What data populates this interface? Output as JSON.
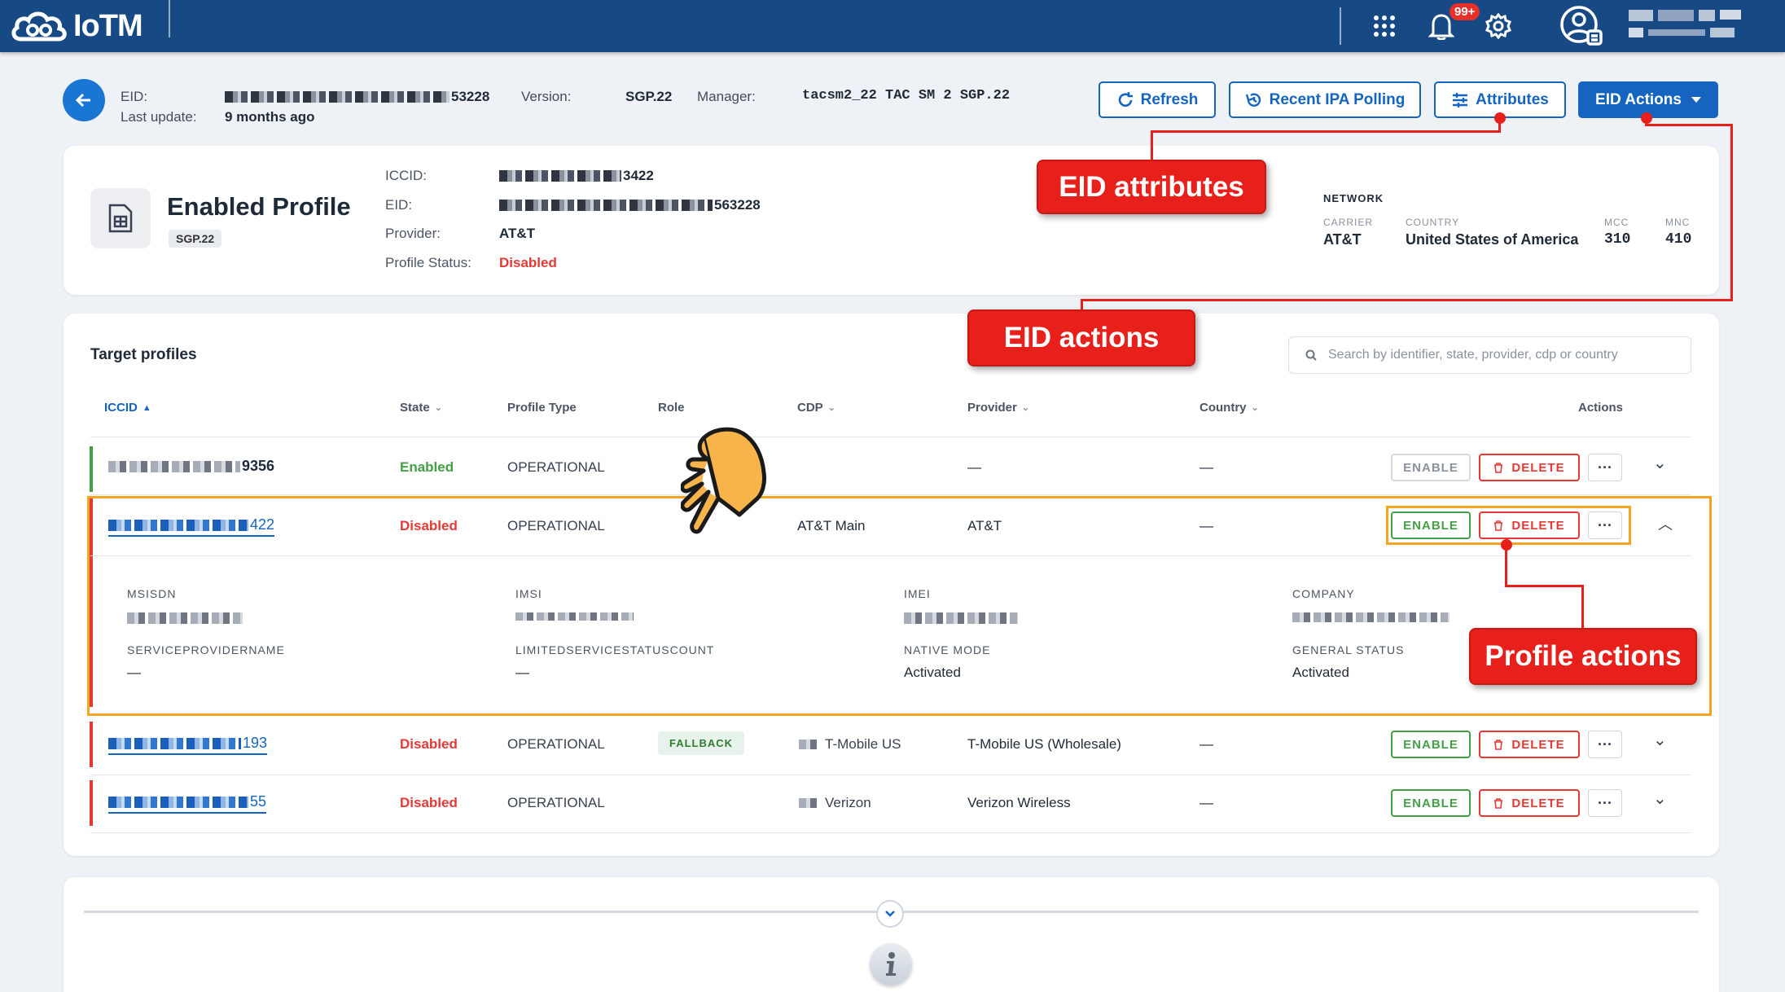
{
  "topbar": {
    "app_name": "IoTM",
    "notification_count": "99+",
    "icons": [
      "apps-grid-icon",
      "bell-icon",
      "gear-icon",
      "user-avatar-icon"
    ]
  },
  "header": {
    "eid_label": "EID:",
    "eid_value": "53228",
    "last_update_label": "Last update:",
    "last_update_value": "9 months ago",
    "version_label": "Version:",
    "version_value": "SGP.22",
    "manager_label": "Manager:",
    "manager_value": "tacsm2_22 TAC SM 2 SGP.22",
    "buttons": {
      "refresh": "Refresh",
      "recent_ipa": "Recent IPA Polling",
      "attributes": "Attributes",
      "eid_actions": "EID Actions"
    }
  },
  "enabled_profile": {
    "title": "Enabled Profile",
    "badge": "SGP.22",
    "iccid_label": "ICCID:",
    "iccid_value": "3422",
    "eid_label": "EID:",
    "eid_value": "563228",
    "provider_label": "Provider:",
    "provider_value": "AT&T",
    "status_label": "Profile Status:",
    "status_value": "Disabled",
    "network": {
      "heading": "NETWORK",
      "carrier_label": "CARRIER",
      "carrier_value": "AT&T",
      "country_label": "COUNTRY",
      "country_value": "United States of America",
      "mcc_label": "MCC",
      "mcc_value": "310",
      "mnc_label": "MNC",
      "mnc_value": "410"
    }
  },
  "target_profiles": {
    "title": "Target profiles",
    "search_placeholder": "Search by identifier, state, provider, cdp or country",
    "columns": {
      "iccid": "ICCID",
      "state": "State",
      "profile_type": "Profile Type",
      "role": "Role",
      "cdp": "CDP",
      "provider": "Provider",
      "country": "Country",
      "actions": "Actions"
    },
    "action_labels": {
      "enable": "ENABLE",
      "delete": "DELETE",
      "more": "···"
    },
    "rows": [
      {
        "iccid_tail": "9356",
        "state": "Enabled",
        "profile_type": "OPERATIONAL",
        "role": "",
        "cdp": "",
        "provider": "—",
        "country": "—"
      },
      {
        "iccid_tail": "422",
        "state": "Disabled",
        "profile_type": "OPERATIONAL",
        "role": "",
        "cdp": "AT&T Main",
        "provider": "AT&T",
        "country": "—"
      },
      {
        "iccid_tail": "193",
        "state": "Disabled",
        "profile_type": "OPERATIONAL",
        "role": "FALLBACK",
        "cdp": "T-Mobile US",
        "provider": "T-Mobile US (Wholesale)",
        "country": "—"
      },
      {
        "iccid_tail": "55",
        "state": "Disabled",
        "profile_type": "OPERATIONAL",
        "role": "",
        "cdp": "Verizon",
        "provider": "Verizon Wireless",
        "country": "—"
      }
    ],
    "details": {
      "msisdn_label": "MSISDN",
      "imsi_label": "IMSI",
      "imei_label": "IMEI",
      "company_label": "COMPANY",
      "spn_label": "SERVICEPROVIDERNAME",
      "spn_value": "—",
      "lsc_label": "LIMITEDSERVICESTATUSCOUNT",
      "lsc_value": "—",
      "native_mode_label": "NATIVE MODE",
      "native_mode_value": "Activated",
      "general_status_label": "GENERAL STATUS",
      "general_status_value": "Activated"
    }
  },
  "annotations": {
    "eid_attributes": "EID attributes",
    "eid_actions": "EID actions",
    "profile_actions": "Profile actions"
  },
  "colors": {
    "topbar": "#174a84",
    "primary": "#1565c0",
    "enabled": "#43a047",
    "disabled": "#e53935",
    "callout": "#e8201b",
    "highlight": "#f5a51f"
  }
}
